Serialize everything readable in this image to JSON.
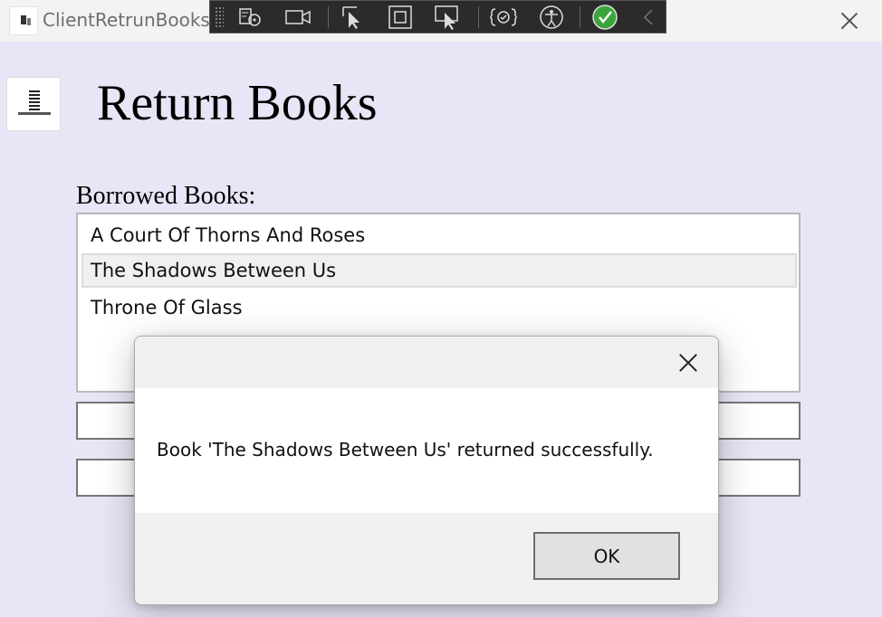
{
  "window": {
    "title": "ClientRetrunBooks",
    "icon": "app-icon",
    "close_icon": "close-icon"
  },
  "debug_toolbar": {
    "tools": [
      "select-element-icon",
      "record-icon",
      "select-cursor-icon",
      "display-layout-adorners-icon",
      "track-focus-icon",
      "hot-reload-icon",
      "accessibility-icon",
      "checked-ok-icon",
      "collapse-chevron-icon"
    ],
    "colors": {
      "background": "#2b2b2b",
      "ok_green": "#3ba53b"
    }
  },
  "main": {
    "logo_icon": "books-logo-icon",
    "title": "Return Books",
    "borrowed_label": "Borrowed Books:",
    "books": [
      {
        "title": "A Court Of Thorns And Roses",
        "selected": false
      },
      {
        "title": "The Shadows Between Us",
        "selected": true
      },
      {
        "title": "Throne Of Glass",
        "selected": false
      }
    ],
    "background_color": "#e6e6f7"
  },
  "dialog": {
    "message": "Book 'The Shadows Between Us' returned successfully.",
    "ok_label": "OK",
    "close_icon": "close-icon"
  }
}
